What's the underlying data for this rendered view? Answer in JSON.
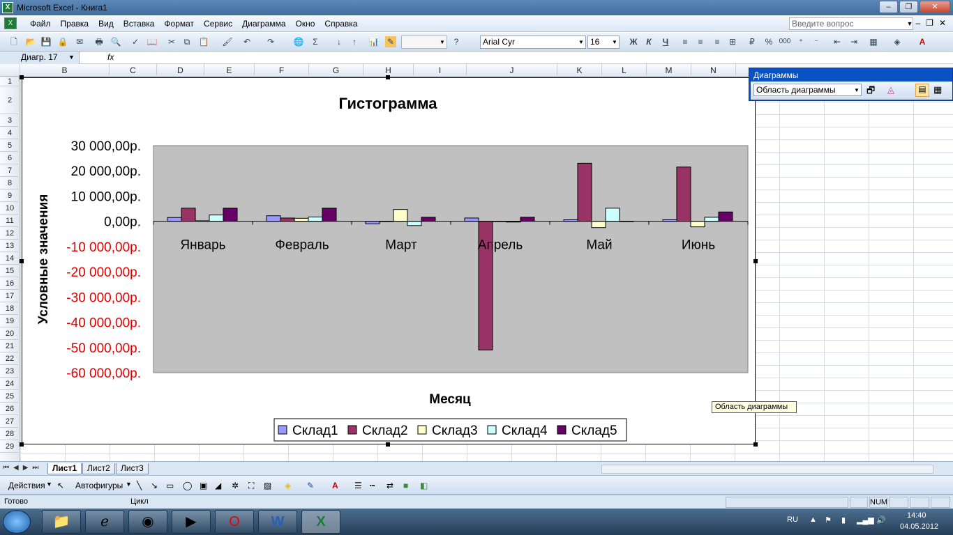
{
  "window": {
    "title": "Microsoft Excel - Книга1",
    "icon_label": "X",
    "buttons": [
      "–",
      "❐",
      "✕"
    ]
  },
  "menubar": {
    "items": [
      "Файл",
      "Правка",
      "Вид",
      "Вставка",
      "Формат",
      "Сервис",
      "Диаграмма",
      "Окно",
      "Справка"
    ],
    "help_placeholder": "Введите вопрос",
    "mdi_buttons": [
      "–",
      "❐",
      "✕"
    ]
  },
  "toolbar": {
    "font_name": "Arial Cyr",
    "font_size": "16",
    "bold": "Ж",
    "italic": "К",
    "underline": "Ч",
    "percent": "%",
    "thousands": "000"
  },
  "formulabar": {
    "name_box": "Диагр. 17",
    "fx": "fx"
  },
  "columns": [
    "B",
    "C",
    "D",
    "E",
    "F",
    "G",
    "H",
    "I",
    "J",
    "K",
    "L",
    "M",
    "N"
  ],
  "rows": [
    "1",
    "2",
    "3",
    "4",
    "5",
    "6",
    "7",
    "8",
    "9",
    "10",
    "11",
    "12",
    "13",
    "14",
    "15",
    "16",
    "17",
    "18",
    "19",
    "20",
    "21",
    "22",
    "23",
    "24",
    "25",
    "26",
    "27",
    "28",
    "29"
  ],
  "chart_data": {
    "type": "bar",
    "title": "Гистограмма",
    "xlabel": "Месяц",
    "ylabel": "Условные значения",
    "categories": [
      "Январь",
      "Февраль",
      "Март",
      "Апрель",
      "Май",
      "Июнь"
    ],
    "ylim": [
      -60000,
      30000
    ],
    "yticks": [
      "30 000,00р.",
      "20 000,00р.",
      "10 000,00р.",
      "0,00р.",
      "-10 000,00р.",
      "-20 000,00р.",
      "-30 000,00р.",
      "-40 000,00р.",
      "-50 000,00р.",
      "-60 000,00р."
    ],
    "ytick_values": [
      30000,
      20000,
      10000,
      0,
      -10000,
      -20000,
      -30000,
      -40000,
      -50000,
      -60000
    ],
    "legend_position": "bottom",
    "plot_background": "#c0c0c0",
    "series": [
      {
        "name": "Склад1",
        "color": "#9999ff",
        "values": [
          1500,
          2200,
          -1000,
          1300,
          600,
          600
        ]
      },
      {
        "name": "Склад2",
        "color": "#993366",
        "values": [
          5200,
          1300,
          0,
          -51000,
          23000,
          21500
        ]
      },
      {
        "name": "Склад3",
        "color": "#ffffcc",
        "values": [
          200,
          1200,
          4700,
          0,
          -2500,
          -2200
        ]
      },
      {
        "name": "Склад4",
        "color": "#ccffff",
        "values": [
          2500,
          1700,
          -1700,
          -300,
          5200,
          1600
        ]
      },
      {
        "name": "Склад5",
        "color": "#660066",
        "values": [
          5200,
          5200,
          1600,
          1600,
          0,
          3700
        ]
      }
    ]
  },
  "diagram_toolbar": {
    "title": "Диаграммы",
    "selected_element": "Область диаграммы"
  },
  "tooltip": "Область диаграммы",
  "sheets": {
    "tabs": [
      "Лист1",
      "Лист2",
      "Лист3"
    ],
    "active": "Лист1"
  },
  "drawbar": {
    "actions_label": "Действия",
    "autoshapes_label": "Автофигуры"
  },
  "status": {
    "ready": "Готово",
    "mode": "Цикл",
    "num": "NUM"
  },
  "taskbar": {
    "lang": "RU",
    "time": "14:40",
    "date": "04.05.2012"
  }
}
